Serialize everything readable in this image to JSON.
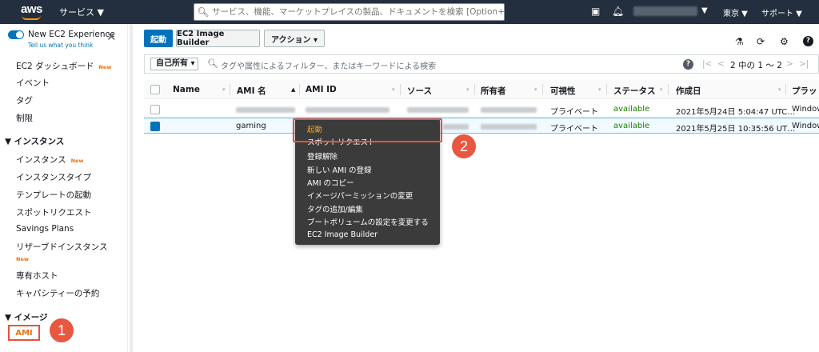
{
  "topbar": {
    "logo": "aws",
    "services": "サービス ▼",
    "search_placeholder": "サービス、機能、マーケットプレイスの製品、ドキュメントを検索 [Option+S]",
    "region": "東京 ▼",
    "support": "サポート ▼"
  },
  "sidebar": {
    "experience_title": "New EC2 Experience",
    "experience_link": "Tell us what you think",
    "dashboard": "EC2 ダッシュボード",
    "new_badge": "New",
    "events": "イベント",
    "tags": "タグ",
    "limits": "制限",
    "section_instances": "▼ インスタンス",
    "instances": "インスタンス",
    "instance_types": "インスタンスタイプ",
    "launch_templates": "テンプレートの起動",
    "spot_requests": "スポットリクエスト",
    "savings_plans": "Savings Plans",
    "reserved_instances": "リザーブドインスタンス",
    "dedicated_hosts": "専有ホスト",
    "capacity_reservations": "キャパシティーの予約",
    "section_images": "▼ イメージ",
    "ami": "AMI"
  },
  "toolbar": {
    "launch": "起動",
    "image_builder": "EC2 Image Builder",
    "actions": "アクション ▾"
  },
  "filter": {
    "owner": "自己所有 ▾",
    "placeholder": "タグや属性によるフィルター、またはキーワードによる検索",
    "pagination": "2 中の 1 〜 2"
  },
  "table": {
    "headers": [
      "Name",
      "AMI 名",
      "AMI ID",
      "ソース",
      "所有者",
      "可視性",
      "ステータス",
      "作成日",
      "プラッ"
    ],
    "rows": [
      {
        "name": "",
        "ami_name": "",
        "visibility": "プライベート",
        "status": "available",
        "created": "2021年5月24日 5:04:47 UTC…",
        "platform": "Window"
      },
      {
        "name": "",
        "ami_name": "gaming",
        "visibility": "プライベート",
        "status": "available",
        "created": "2021年5月25日 10:35:56 UT…",
        "platform": "Window"
      }
    ]
  },
  "context_menu": {
    "items": [
      "起動",
      "スポットリクエスト",
      "登録解除",
      "新しい AMI の登録",
      "AMI のコピー",
      "イメージパーミッションの変更",
      "タグの追加/編集",
      "ブートボリュームの設定を変更する",
      "EC2 Image Builder"
    ]
  },
  "badges": {
    "step1": "1",
    "step2": "2"
  },
  "colors": {
    "nav_bg": "#232f3e",
    "primary": "#0073bb",
    "accent": "#ec7211",
    "highlight": "#e25440",
    "available": "#1d8102"
  }
}
